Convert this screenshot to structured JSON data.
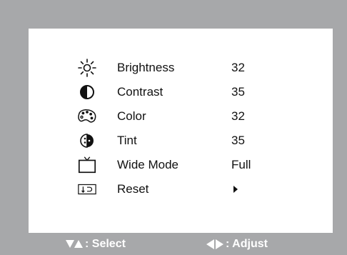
{
  "menu": {
    "items": [
      {
        "label": "Brightness",
        "value": "32",
        "icon": "sun-icon"
      },
      {
        "label": "Contrast",
        "value": "35",
        "icon": "contrast-icon"
      },
      {
        "label": "Color",
        "value": "32",
        "icon": "palette-icon"
      },
      {
        "label": "Tint",
        "value": "35",
        "icon": "tint-icon"
      },
      {
        "label": "Wide Mode",
        "value": "Full",
        "icon": "tv-icon"
      },
      {
        "label": "Reset",
        "value": "",
        "icon": "reset-icon"
      }
    ]
  },
  "footer": {
    "select_label": ": Select",
    "adjust_label": ": Adjust"
  },
  "colors": {
    "frame": "#a7a8aa",
    "panel": "#ffffff",
    "text": "#111111"
  }
}
